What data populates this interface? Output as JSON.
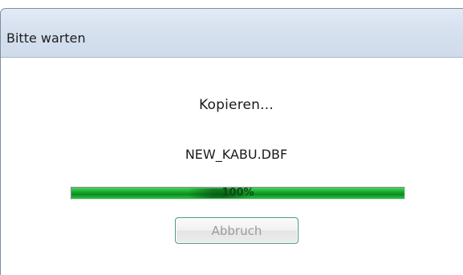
{
  "window": {
    "title": "Bitte warten"
  },
  "dialog": {
    "operation_text": "Kopieren...",
    "file_name": "NEW_KABU.DBF",
    "progress": {
      "percent": 100,
      "label": "100%",
      "color": "#16a82c"
    },
    "cancel_label": "Abbruch",
    "cancel_enabled": false
  }
}
